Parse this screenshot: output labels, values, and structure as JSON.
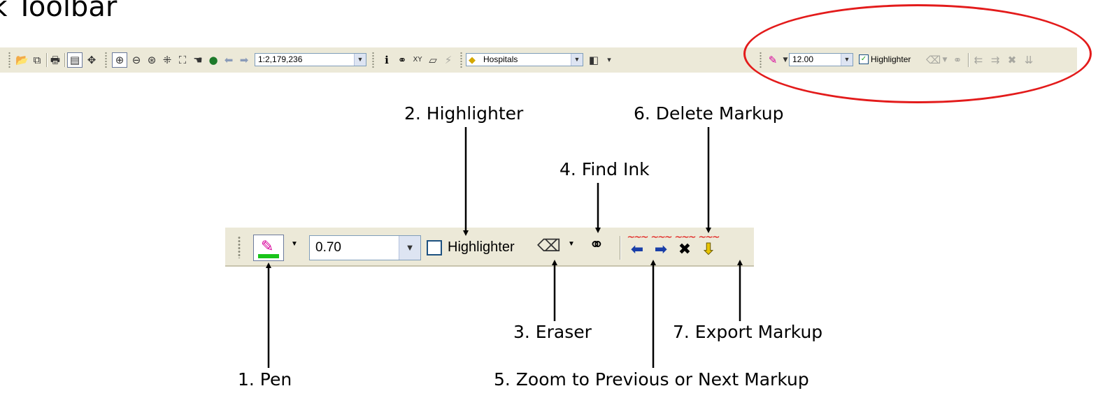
{
  "title": "nk Toolbar",
  "full_toolbar": {
    "scale_value": "1:2,179,236",
    "layer_value": "Hospitals",
    "ink_size_value": "12.00",
    "highlighter_label": "Highlighter",
    "highlighter_checked": true
  },
  "ink_toolbar": {
    "pen_color": "#19c419",
    "size_value": "0.70",
    "highlighter_label": "Highlighter",
    "highlighter_checked": false
  },
  "callouts": {
    "pen": "1. Pen",
    "highlighter": "2. Highlighter",
    "eraser": "3. Eraser",
    "find_ink": "4. Find Ink",
    "zoom_markup": "5. Zoom to Previous or Next Markup",
    "delete_markup": "6. Delete Markup",
    "export_markup": "7. Export Markup"
  },
  "colors": {
    "ellipse": "#e31b1b",
    "toolbar_bg": "#ece9d8"
  }
}
